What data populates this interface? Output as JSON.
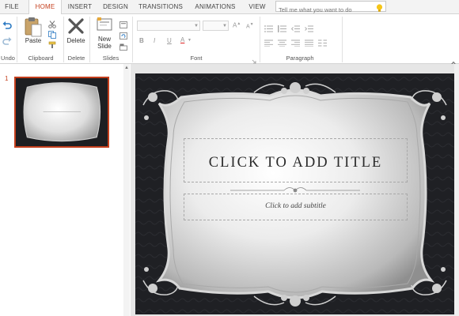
{
  "tabs": [
    "FILE",
    "HOME",
    "INSERT",
    "DESIGN",
    "TRANSITIONS",
    "ANIMATIONS",
    "VIEW"
  ],
  "tell_me": {
    "placeholder": "Tell me what you want to do"
  },
  "ribbon": {
    "paste_label": "Paste",
    "delete_label": "Delete",
    "new_slide_label": "New Slide",
    "groups": {
      "undo": "Undo",
      "clipboard": "Clipboard",
      "delete": "Delete",
      "slides": "Slides",
      "font": "Font",
      "paragraph": "Paragraph"
    },
    "font_buttons": {
      "bold": "B",
      "italic": "I",
      "underline": "U",
      "font_color": "A"
    }
  },
  "thumbnail": {
    "number": "1"
  },
  "slide": {
    "title": "CLICK TO ADD TITLE",
    "subtitle": "Click to add subtitle"
  },
  "colors": {
    "accent": "#c43e1c",
    "slide_bg": "#1e1f22"
  }
}
